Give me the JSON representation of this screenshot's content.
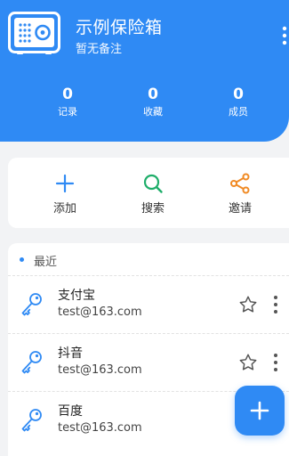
{
  "vault": {
    "title": "示例保险箱",
    "note": "暂无备注",
    "stats": [
      {
        "value": "0",
        "label": "记录"
      },
      {
        "value": "0",
        "label": "收藏"
      },
      {
        "value": "0",
        "label": "成员"
      }
    ]
  },
  "actions": [
    {
      "label": "添加",
      "icon": "plus-icon",
      "color": "#2f8af4"
    },
    {
      "label": "搜索",
      "icon": "search-icon",
      "color": "#1fae6a"
    },
    {
      "label": "邀请",
      "icon": "share-icon",
      "color": "#f08a24"
    }
  ],
  "recent": {
    "title": "最近",
    "items": [
      {
        "name": "支付宝",
        "account": "test@163.com"
      },
      {
        "name": "抖音",
        "account": "test@163.com"
      },
      {
        "name": "百度",
        "account": "test@163.com"
      }
    ]
  },
  "colors": {
    "primary": "#2f8af4",
    "search": "#1fae6a",
    "invite": "#f08a24",
    "background": "#f2f3f5"
  }
}
